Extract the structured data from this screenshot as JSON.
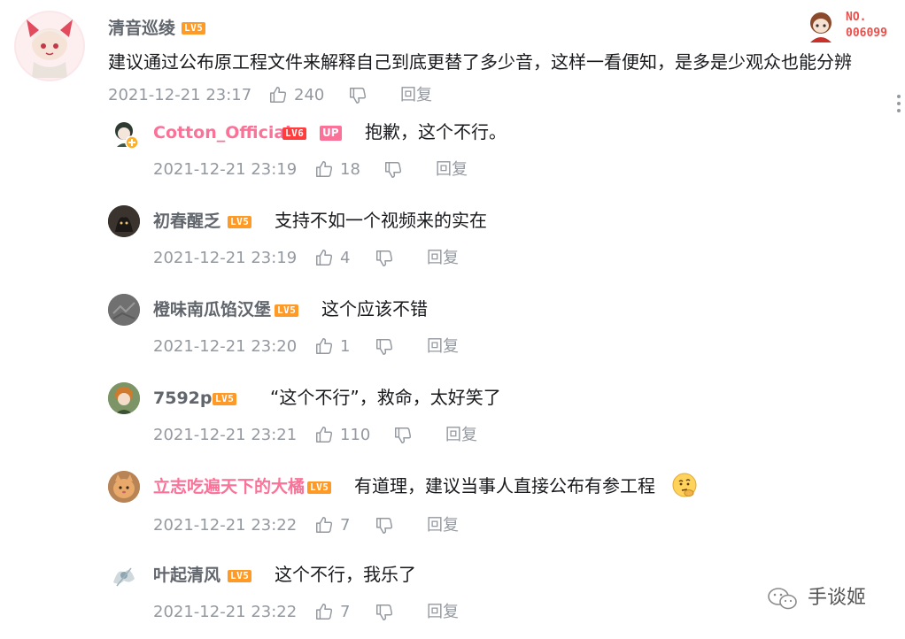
{
  "main_comment": {
    "username": "清音巡绫",
    "level": "LV5",
    "text": "建议通过公布原工程文件来解释自己到底更替了多少音，这样一看便知，是多是少观众也能分辨",
    "date": "2021-12-21 23:17",
    "likes": "240",
    "reply_label": "回复"
  },
  "fan_badge": {
    "line1": "NO.",
    "line2": "006099"
  },
  "replies": [
    {
      "username": "Cotton_Official",
      "level": "LV6",
      "up_badge": "UP",
      "text": "抱歉，这个不行。",
      "date": "2021-12-21 23:19",
      "likes": "18",
      "reply_label": "回复"
    },
    {
      "username": "初春醒乏",
      "level": "LV5",
      "text": "支持不如一个视频来的实在",
      "date": "2021-12-21 23:19",
      "likes": "4",
      "reply_label": "回复"
    },
    {
      "username": "橙味南瓜馅汉堡",
      "level": "LV5",
      "text": "这个应该不错",
      "date": "2021-12-21 23:20",
      "likes": "1",
      "reply_label": "回复"
    },
    {
      "username": "7592p",
      "level": "LV5",
      "text": "“这个不行”，救命，太好笑了",
      "date": "2021-12-21 23:21",
      "likes": "110",
      "reply_label": "回复"
    },
    {
      "username": "立志吃遍天下的大橘",
      "level": "LV5",
      "text": "有道理，建议当事人直接公布有参工程",
      "date": "2021-12-21 23:22",
      "likes": "7",
      "reply_label": "回复"
    },
    {
      "username": "叶起清风",
      "level": "LV5",
      "text": "这个不行，我乐了",
      "date": "2021-12-21 23:22",
      "likes": "7",
      "reply_label": "回复"
    }
  ],
  "watermark": {
    "text": "手谈姬"
  },
  "colors": {
    "vip_pink": "#fb7299",
    "level5": "#ff9a27",
    "level6": "#ff3d3d",
    "meta_gray": "#9499a0"
  }
}
